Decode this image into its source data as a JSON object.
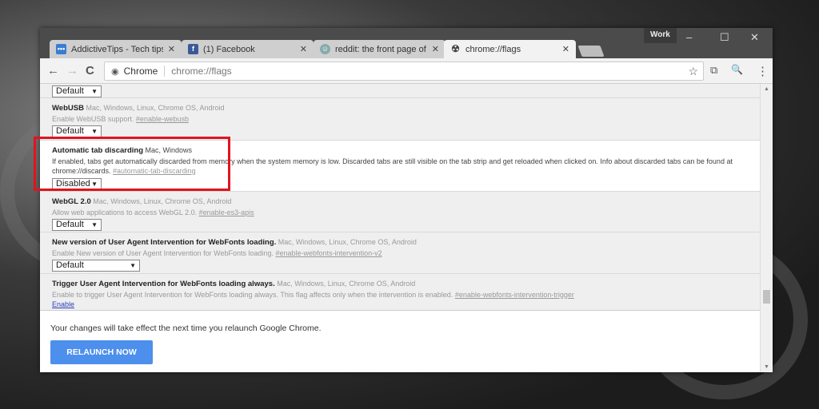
{
  "window": {
    "profile": "Work",
    "minimize": "–",
    "maximize": "☐",
    "close": "✕"
  },
  "tabs": [
    {
      "label": "AddictiveTips - Tech tips",
      "icon": "addictivetips-icon",
      "active": false
    },
    {
      "label": "(1) Facebook",
      "icon": "facebook-icon",
      "active": false
    },
    {
      "label": "reddit: the front page of",
      "icon": "reddit-icon",
      "active": false
    },
    {
      "label": "chrome://flags",
      "icon": "radiation-icon",
      "active": true
    }
  ],
  "toolbar": {
    "back": "←",
    "forward": "→",
    "reload": "C",
    "chip": "Chrome",
    "url": "chrome://flags",
    "star": "☆",
    "cast": "⧉",
    "zoom": "🔍",
    "menu": "⋮"
  },
  "flags": [
    {
      "select": "Default"
    },
    {
      "title": "WebUSB",
      "platforms": "Mac, Windows, Linux, Chrome OS, Android",
      "desc": "Enable WebUSB support.",
      "anchor": "#enable-webusb",
      "select": "Default"
    },
    {
      "title": "Automatic tab discarding",
      "platforms": "Mac, Windows",
      "desc": "If enabled, tabs get automatically discarded from memory when the system memory is low. Discarded tabs are still visible on the tab strip and get reloaded when clicked on. Info about discarded tabs can be found at chrome://discards.",
      "anchor": "#automatic-tab-discarding",
      "select": "Disabled"
    },
    {
      "title": "WebGL 2.0",
      "platforms": "Mac, Windows, Linux, Chrome OS, Android",
      "desc": "Allow web applications to access WebGL 2.0.",
      "anchor": "#enable-es3-apis",
      "select": "Default"
    },
    {
      "title": "New version of User Agent Intervention for WebFonts loading.",
      "platforms": "Mac, Windows, Linux, Chrome OS, Android",
      "desc": "Enable New version of User Agent Intervention for WebFonts loading.",
      "anchor": "#enable-webfonts-intervention-v2",
      "select": "Default"
    },
    {
      "title": "Trigger User Agent Intervention for WebFonts loading always.",
      "platforms": "Mac, Windows, Linux, Chrome OS, Android",
      "desc": "Enable to trigger User Agent Intervention for WebFonts loading always. This flag affects only when the intervention is enabled.",
      "anchor": "#enable-webfonts-intervention-trigger",
      "link": "Enable"
    }
  ],
  "bottom": {
    "message": "Your changes will take effect the next time you relaunch Google Chrome.",
    "button": "RELAUNCH NOW"
  },
  "colors": {
    "highlight": "#e0141e",
    "button": "#4d8fec"
  }
}
